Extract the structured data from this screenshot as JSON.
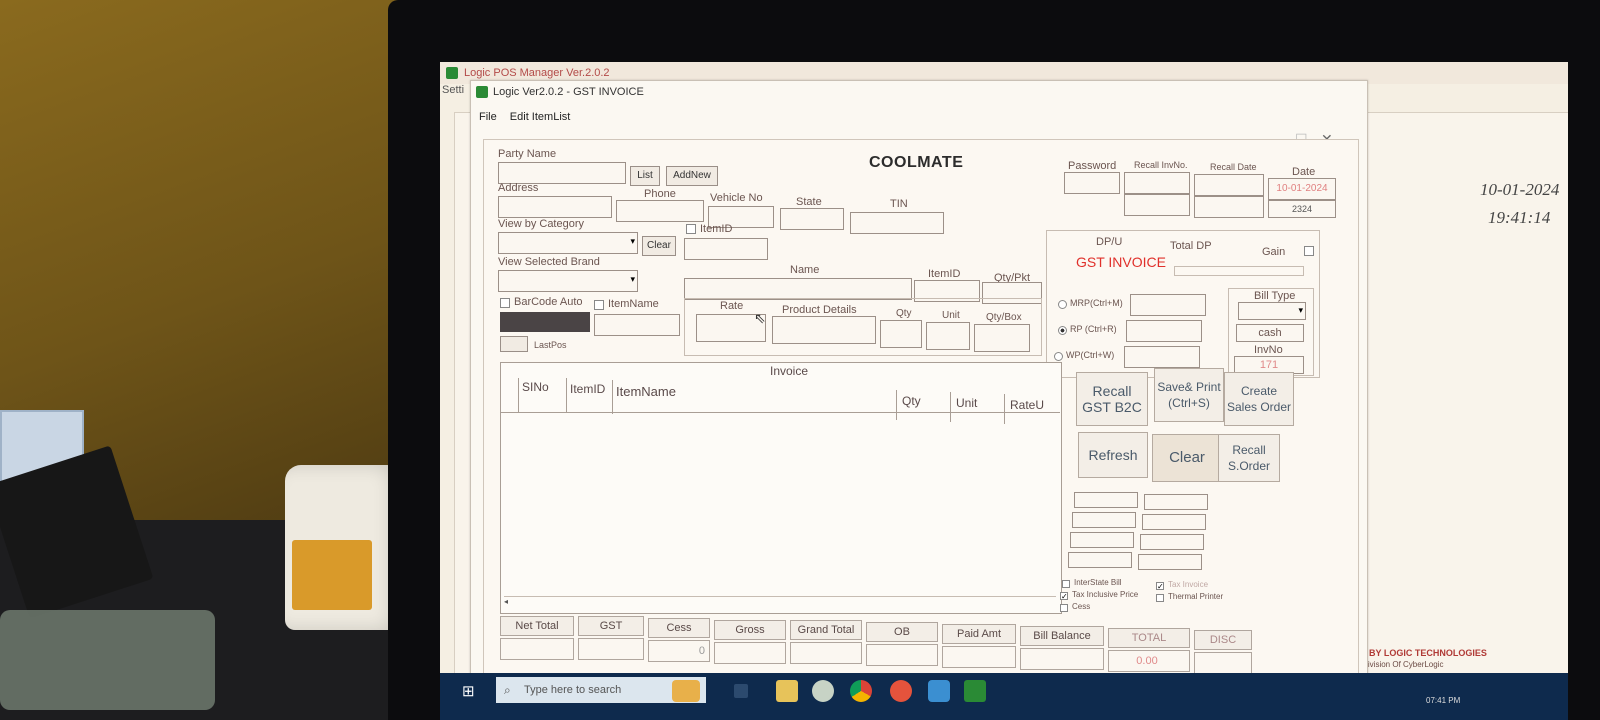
{
  "parent_window": {
    "title": "Logic POS Manager Ver.2.0.2",
    "menu_partial": "Setti",
    "date": "10-01-2024",
    "time": "19:41:14",
    "powered_by": "POWERED BY LOGIC TECHNOLOGIES",
    "division": "A Division Of CyberLogic"
  },
  "invoice_window": {
    "title": "Logic Ver2.0.2 - GST INVOICE",
    "menu": [
      "File",
      "Edit ItemList"
    ],
    "header": "COOLMATE",
    "party": {
      "party_name_label": "Party Name",
      "list_button": "List",
      "addnew_button": "AddNew",
      "address_label": "Address",
      "phone_label": "Phone",
      "vehicle_label": "Vehicle No",
      "state_label": "State",
      "tin_label": "TIN"
    },
    "right_top": {
      "password_label": "Password",
      "recall_invno_label": "Recall InvNo.",
      "recall_date_label": "Recall Date",
      "date_label": "Date",
      "date_value": "10-01-2024",
      "date_sub_value": "2324"
    },
    "category": {
      "view_category_label": "View by Category",
      "clear_button": "Clear",
      "itemid_check_label": "ItemID",
      "view_brand_label": "View Selected Brand"
    },
    "item_entry": {
      "name_label": "Name",
      "itemid_label": "ItemID",
      "qty_pkt_label": "Qty/Pkt",
      "barcode_auto_label": "BarCode Auto",
      "itemname_label": "ItemName",
      "rate_label": "Rate",
      "product_details_label": "Product Details",
      "qty_label": "Qty",
      "unit_label": "Unit",
      "qty_box_label": "Qty/Box",
      "lastpos_label": "LastPos"
    },
    "pricing": {
      "dpu_label": "DP/U",
      "total_dp_label": "Total DP",
      "gain_label": "Gain",
      "gst_invoice_text": "GST INVOICE",
      "mrp_label": "MRP(Ctrl+M)",
      "rp_label": "RP (Ctrl+R)",
      "wp_label": "WP(Ctrl+W)",
      "selected_price": "rp",
      "bill_type_label": "Bill Type",
      "bill_type_value": "cash",
      "invno_label": "InvNo",
      "invno_value": "171"
    },
    "grid": {
      "title": "Invoice",
      "columns": [
        "SINo",
        "ItemID",
        "ItemName",
        "Qty",
        "Unit",
        "RateU"
      ],
      "rows": []
    },
    "actions": {
      "recall_gst_b2c": "Recall GST B2C",
      "save_print": "Save& Print (Ctrl+S)",
      "create_sales_order": "Create Sales Order",
      "refresh": "Refresh",
      "clear": "Clear",
      "recall_sorder": "Recall S.Order"
    },
    "options": {
      "interstate_bill": "InterState Bill",
      "tax_inclusive": "Tax Inclusive Price",
      "tax_invoice": "Tax Invoice",
      "thermal_printer": "Thermal Printer",
      "cess": "Cess",
      "tax_inclusive_checked": true,
      "tax_invoice_checked": true
    },
    "totals": {
      "labels": [
        "Net Total",
        "GST",
        "Cess",
        "Gross",
        "Grand Total",
        "OB",
        "Paid Amt",
        "Bill Balance"
      ],
      "cess_value": "0",
      "total_label": "TOTAL",
      "disc_label": "DISC",
      "total_value": "0.00"
    }
  },
  "taskbar": {
    "search_placeholder": "Type here to search",
    "clock": "07:41 PM"
  }
}
